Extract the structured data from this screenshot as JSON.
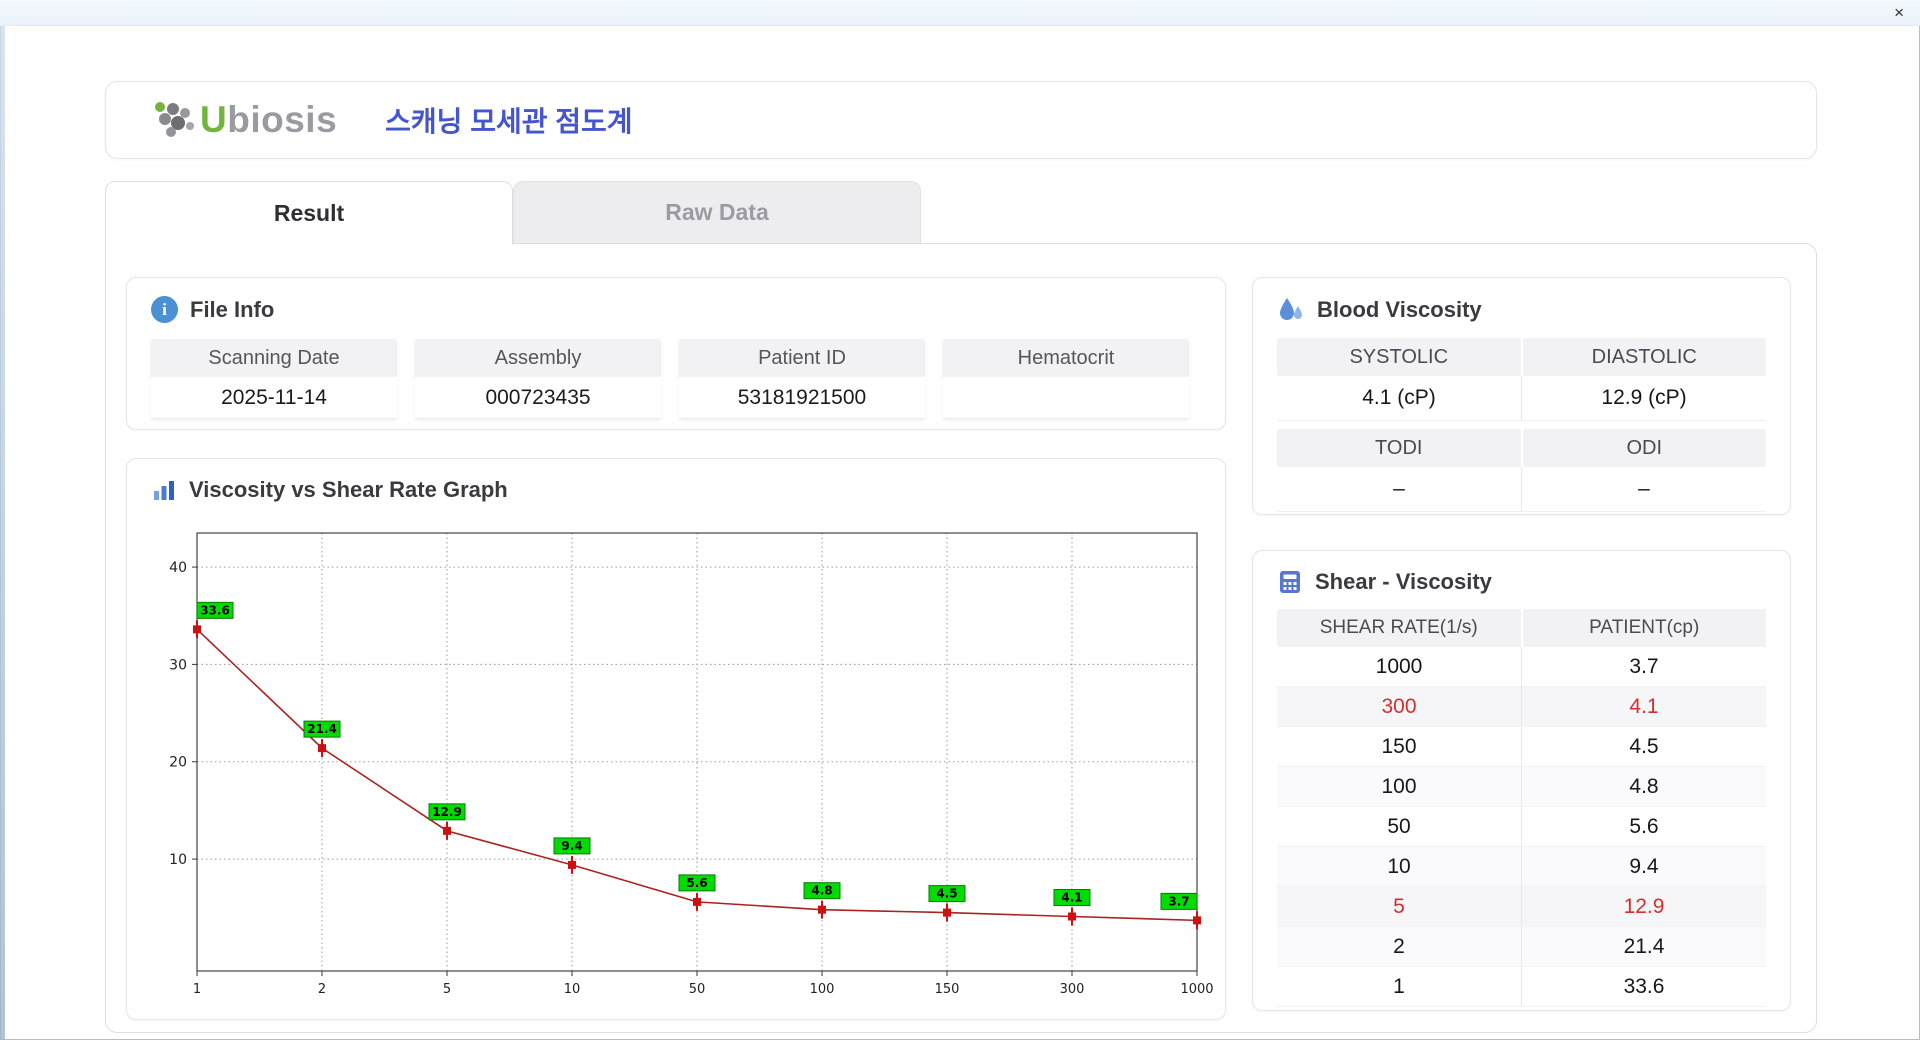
{
  "window": {
    "close_glyph": "×"
  },
  "header": {
    "logo_u": "U",
    "logo_rest": "biosis",
    "title": "스캐닝 모세관 점도계"
  },
  "tabs": [
    {
      "label": "Result",
      "active": true
    },
    {
      "label": "Raw Data",
      "active": false
    }
  ],
  "file_info": {
    "title": "File Info",
    "fields": [
      {
        "label": "Scanning Date",
        "value": "2025-11-14"
      },
      {
        "label": "Assembly",
        "value": "000723435"
      },
      {
        "label": "Patient ID",
        "value": "53181921500"
      },
      {
        "label": "Hematocrit",
        "value": ""
      }
    ]
  },
  "blood_viscosity": {
    "title": "Blood Viscosity",
    "headers1": [
      "SYSTOLIC",
      "DIASTOLIC"
    ],
    "values1": [
      "4.1 (cP)",
      "12.9 (cP)"
    ],
    "headers2": [
      "TODI",
      "ODI"
    ],
    "values2": [
      "–",
      "–"
    ]
  },
  "shear_viscosity": {
    "title": "Shear - Viscosity",
    "columns": [
      "SHEAR RATE(1/s)",
      "PATIENT(cp)"
    ],
    "rows": [
      {
        "rate": "1000",
        "patient": "3.7",
        "highlight": false
      },
      {
        "rate": "300",
        "patient": "4.1",
        "highlight": true
      },
      {
        "rate": "150",
        "patient": "4.5",
        "highlight": false
      },
      {
        "rate": "100",
        "patient": "4.8",
        "highlight": false
      },
      {
        "rate": "50",
        "patient": "5.6",
        "highlight": false
      },
      {
        "rate": "10",
        "patient": "9.4",
        "highlight": false
      },
      {
        "rate": "5",
        "patient": "12.9",
        "highlight": true
      },
      {
        "rate": "2",
        "patient": "21.4",
        "highlight": false
      },
      {
        "rate": "1",
        "patient": "33.6",
        "highlight": false
      }
    ]
  },
  "chart_data": {
    "type": "line",
    "title": "Viscosity vs Shear Rate Graph",
    "x_categories": [
      "1",
      "2",
      "5",
      "10",
      "50",
      "100",
      "150",
      "300",
      "1000"
    ],
    "values": [
      33.6,
      21.4,
      12.9,
      9.4,
      5.6,
      4.8,
      4.5,
      4.1,
      3.7
    ],
    "xlabel": "",
    "ylabel": "",
    "y_ticks": [
      10,
      20,
      30,
      40
    ],
    "ylim": [
      -1.5,
      43.5
    ],
    "x_scale": "categorical",
    "grid": true,
    "legend": false,
    "line_color": "#aa2222",
    "marker_color": "#cc1111",
    "label_bg": "#00dc00"
  },
  "icons": {
    "info_glyph": "i"
  },
  "colors": {
    "accent_blue": "#4555cd",
    "logo_green": "#72b43e",
    "logo_gray": "#9a9aa0",
    "icon_blue": "#4a90d2",
    "highlight_red": "#d2302c"
  }
}
